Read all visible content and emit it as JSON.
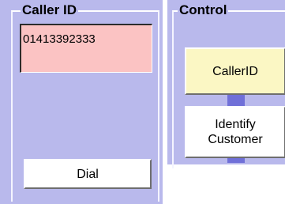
{
  "caller_id_group": {
    "title": "Caller ID",
    "number": "01413392333",
    "dial_label": "Dial"
  },
  "control_group": {
    "title": "Control",
    "callerid_label": "CallerID",
    "identify_label_line1": "Identify",
    "identify_label_line2": "Customer"
  },
  "colors": {
    "panel_bg": "#b9b9ec",
    "caller_box_bg": "#fbc3c3",
    "callerid_button_bg": "#fbf7c4",
    "connector": "#7070d8"
  }
}
